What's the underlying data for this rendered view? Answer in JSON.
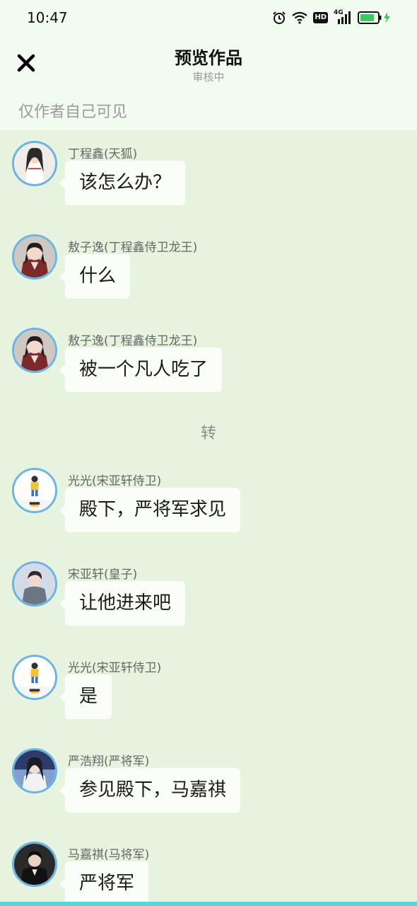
{
  "status_bar": {
    "time": "10:47",
    "network": "4G",
    "hd_label": "HD"
  },
  "header": {
    "title": "预览作品",
    "subtitle": "审核中",
    "visibility_note": "仅作者自己可见"
  },
  "messages": [
    {
      "sender": "丁程鑫(天狐)",
      "text": "该怎么办？",
      "avatar": "avatar-white-robe"
    },
    {
      "sender": "敖子逸(丁程鑫侍卫龙王)",
      "text": "什么",
      "avatar": "avatar-red-robe"
    },
    {
      "sender": "敖子逸(丁程鑫侍卫龙王)",
      "text": "被一个凡人吃了",
      "avatar": "avatar-red-robe"
    },
    {
      "sender": "光光(宋亚轩侍卫)",
      "text": "殿下，严将军求见",
      "avatar": "avatar-cartoon-figure"
    },
    {
      "sender": "宋亚轩(皇子)",
      "text": "让他进来吧",
      "avatar": "avatar-gray-coat"
    },
    {
      "sender": "光光(宋亚轩侍卫)",
      "text": "是",
      "avatar": "avatar-cartoon-figure"
    },
    {
      "sender": "严浩翔(严将军)",
      "text": "参见殿下，马嘉祺",
      "avatar": "avatar-white-dress"
    },
    {
      "sender": "马嘉祺(马将军)",
      "text": "严将军",
      "avatar": "avatar-dark-suit"
    }
  ],
  "scene_divider": "转",
  "colors": {
    "background": "#e6f3df",
    "header_bg": "#f2fbef",
    "avatar_ring": "#6bb4e4",
    "bubble": "#fafdf8",
    "accent_strip": "#55d6df"
  }
}
